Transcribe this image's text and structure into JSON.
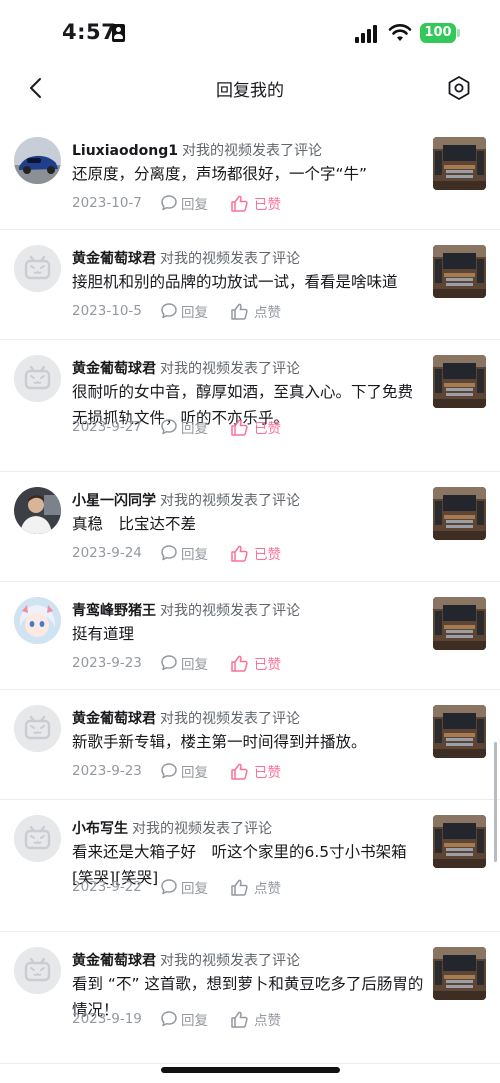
{
  "status_bar": {
    "time": "4:57",
    "battery": "100",
    "battery_color": "#34c759"
  },
  "nav": {
    "title": "回复我的",
    "back_icon": "chevron-left-icon",
    "settings_icon": "settings-hexagon-icon"
  },
  "colors": {
    "accent_pink": "#fb7299",
    "secondary_text": "#9499a0"
  },
  "items": [
    {
      "username": "Liuxiaodong1",
      "action": "对我的视频发表了评论",
      "comment": "还原度，分离度，声场都很好，一个字“牛”",
      "date": "2023-10-7",
      "reply": "回复",
      "like": "已赞",
      "liked": true,
      "avatar": "car-photo"
    },
    {
      "username": "黄金葡萄球君",
      "action": "对我的视频发表了评论",
      "comment": "接胆机和别的品牌的功放试一试，看看是啥味道",
      "date": "2023-10-5",
      "reply": "回复",
      "like": "点赞",
      "liked": false,
      "avatar": "default-tv-avatar"
    },
    {
      "username": "黄金葡萄球君",
      "action": "对我的视频发表了评论",
      "comment": "很耐听的女中音，醇厚如酒，至真入心。下了免费无损抓轨文件，听的不亦乐乎。",
      "date": "2023-9-27",
      "reply": "回复",
      "like": "已赞",
      "liked": true,
      "avatar": "default-tv-avatar"
    },
    {
      "username": "小星一闪同学",
      "action": "对我的视频发表了评论",
      "comment": "真稳　比宝达不差",
      "date": "2023-9-24",
      "reply": "回复",
      "like": "已赞",
      "liked": true,
      "avatar": "person-photo"
    },
    {
      "username": "青鸾峰野猪王",
      "action": "对我的视频发表了评论",
      "comment": "挺有道理",
      "date": "2023-9-23",
      "reply": "回复",
      "like": "已赞",
      "liked": true,
      "avatar": "anime-avatar"
    },
    {
      "username": "黄金葡萄球君",
      "action": "对我的视频发表了评论",
      "comment": "新歌手新专辑，楼主第一时间得到并播放。",
      "date": "2023-9-23",
      "reply": "回复",
      "like": "已赞",
      "liked": true,
      "avatar": "default-tv-avatar"
    },
    {
      "username": "小布写生",
      "action": "对我的视频发表了评论",
      "comment": "看来还是大箱子好　听这个家里的6.5寸小书架箱[笑哭][笑哭]",
      "date": "2023-9-22",
      "reply": "回复",
      "like": "点赞",
      "liked": false,
      "avatar": "default-tv-avatar"
    },
    {
      "username": "黄金葡萄球君",
      "action": "对我的视频发表了评论",
      "comment": "看到 “不” 这首歌，想到萝卜和黄豆吃多了后肠胃的情况！",
      "date": "2023-9-19",
      "reply": "回复",
      "like": "点赞",
      "liked": false,
      "avatar": "default-tv-avatar"
    }
  ]
}
